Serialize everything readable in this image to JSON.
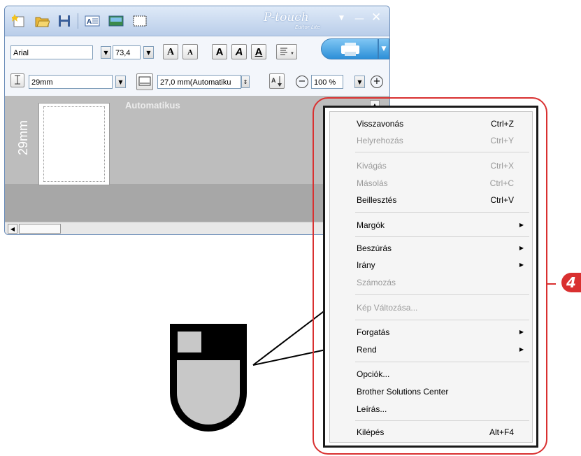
{
  "window": {
    "logo": "P-touch",
    "logo_sub": "Editor Lite"
  },
  "toolbar1": {
    "font_name": "Arial",
    "font_size": "73,4",
    "btn_grow": "A",
    "btn_shrink": "A",
    "btn_bold": "A",
    "btn_italic": "A",
    "btn_underline": "A"
  },
  "toolbar2": {
    "tape_width": "29mm",
    "length": "27,0 mm(Automatiku",
    "zoom": "100 %"
  },
  "canvas": {
    "tape_label": "29mm",
    "auto_text": "Automatikus"
  },
  "menu": {
    "items": [
      {
        "label": "Visszavonás",
        "shortcut": "Ctrl+Z"
      },
      {
        "label": "Helyrehozás",
        "shortcut": "Ctrl+Y"
      },
      {
        "label": "Kivágás",
        "shortcut": "Ctrl+X"
      },
      {
        "label": "Másolás",
        "shortcut": "Ctrl+C"
      },
      {
        "label": "Beillesztés",
        "shortcut": "Ctrl+V"
      },
      {
        "label": "Margók"
      },
      {
        "label": "Beszúrás"
      },
      {
        "label": "Irány"
      },
      {
        "label": "Számozás"
      },
      {
        "label": "Kép Változása..."
      },
      {
        "label": "Forgatás"
      },
      {
        "label": "Rend"
      },
      {
        "label": "Opciók..."
      },
      {
        "label": "Brother Solutions Center"
      },
      {
        "label": "Leírás..."
      },
      {
        "label": "Kilépés",
        "shortcut": "Alt+F4"
      }
    ]
  },
  "callout": {
    "number": "4"
  },
  "colors": {
    "callout": "#d93030",
    "titlebar": "#b9cde9",
    "print_button": "#2d8fd8"
  }
}
